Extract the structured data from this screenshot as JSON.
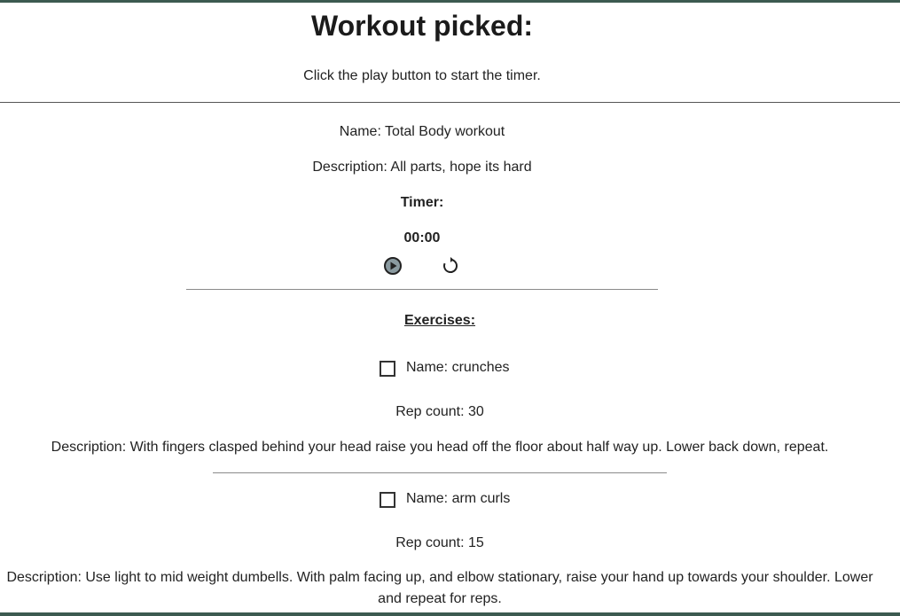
{
  "header": {
    "title": "Workout picked:",
    "instructions": "Click the play button to start the timer."
  },
  "workout": {
    "name": "Name: Total Body workout",
    "description": "Description: All parts, hope its hard"
  },
  "timer": {
    "label": "Timer:",
    "value": "00:00",
    "play_icon": "play-circle-icon",
    "reset_icon": "reset-icon"
  },
  "exercises": {
    "heading": "Exercises:",
    "items": [
      {
        "checked": false,
        "name": "Name: crunches",
        "reps": "Rep count: 30",
        "description": "Description: With fingers clasped behind your head raise you head off the floor about half way up. Lower back down, repeat."
      },
      {
        "checked": false,
        "name": "Name: arm curls",
        "reps": "Rep count: 15",
        "description": "Description: Use light to mid weight dumbells. With palm facing up, and elbow stationary, raise your hand up towards your shoulder. Lower and repeat for reps."
      }
    ]
  },
  "colors": {
    "frame": "#3c5a50",
    "text": "#222222",
    "icon_fill": "#8a9aa0"
  }
}
